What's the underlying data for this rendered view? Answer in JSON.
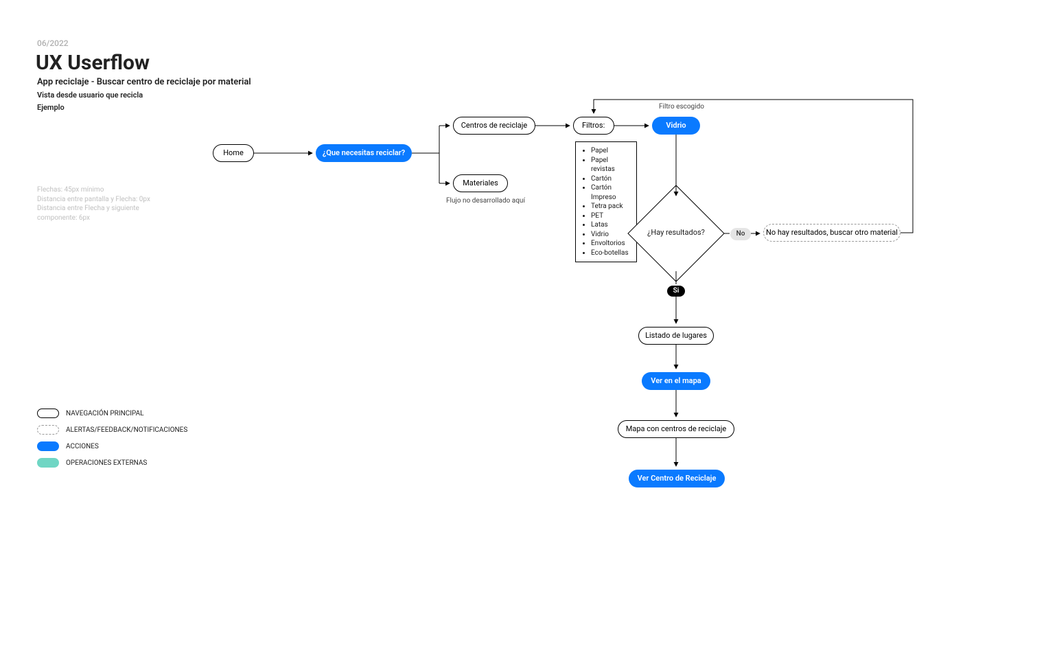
{
  "header": {
    "date": "06/2022",
    "title": "UX Userflow",
    "subtitle": "App reciclaje - Buscar centro de reciclaje por material",
    "subtitle2": "Vista desde usuario que recicla",
    "subtitle3": "Ejemplo"
  },
  "notes": {
    "l1": "Flechas: 45px mínimo",
    "l2": "Distancia entre pantalla y Flecha: 0px",
    "l3": "Distancia entre Flecha y siguiente componente: 6px"
  },
  "legend": {
    "nav": "NAVEGACIÓN PRINCIPAL",
    "alert": "ALERTAS/FEEDBACK/NOTIFICACIONES",
    "action": "ACCIONES",
    "ext": "OPERACIONES EXTERNAS"
  },
  "nodes": {
    "home": "Home",
    "queNecesitas": "¿Que necesitas reciclar?",
    "centros": "Centros de reciclaje",
    "materiales": "Materiales",
    "flujoNo": "Flujo no desarrollado aquí",
    "filtros": "Filtros:",
    "filtroEscogido": "Filtro escogido",
    "vidrio": "Vidrio",
    "hayResultados": "¿Hay resultados?",
    "no": "No",
    "noHay": "No hay resultados, buscar otro material",
    "si": "Si",
    "listado": "Listado de lugares",
    "verMapa": "Ver en el mapa",
    "mapaCentros": "Mapa con  centros de reciclaje",
    "verCentro": "Ver Centro de Reciclaje"
  },
  "filters": {
    "items": [
      "Papel",
      "Papel revistas",
      "Cartón",
      "Cartón Impreso",
      "Tetra pack",
      "PET",
      "Latas",
      "Vidrio",
      "Envoltorios",
      "Eco-botellas"
    ]
  },
  "chart_data": {
    "type": "flowchart",
    "title": "UX Userflow – App reciclaje – Buscar centro de reciclaje por material",
    "legend": {
      "nav": "Navegación principal (pill, black outline)",
      "alert": "Alertas/Feedback/Notificaciones (pill, dashed outline)",
      "action": "Acciones (pill, blue fill)",
      "ext": "Operaciones externas (pill, teal fill)"
    },
    "nodes": [
      {
        "id": "home",
        "label": "Home",
        "kind": "nav"
      },
      {
        "id": "que",
        "label": "¿Que necesitas reciclar?",
        "kind": "action"
      },
      {
        "id": "centros",
        "label": "Centros de reciclaje",
        "kind": "nav"
      },
      {
        "id": "materiales",
        "label": "Materiales",
        "kind": "nav",
        "note": "Flujo no desarrollado aquí"
      },
      {
        "id": "filtros",
        "label": "Filtros:",
        "kind": "nav",
        "options": [
          "Papel",
          "Papel revistas",
          "Cartón",
          "Cartón Impreso",
          "Tetra pack",
          "PET",
          "Latas",
          "Vidrio",
          "Envoltorios",
          "Eco-botellas"
        ]
      },
      {
        "id": "vidrio",
        "label": "Vidrio",
        "kind": "action",
        "note": "Filtro escogido"
      },
      {
        "id": "hay",
        "label": "¿Hay resultados?",
        "kind": "decision"
      },
      {
        "id": "nohay",
        "label": "No hay resultados, buscar otro material",
        "kind": "alert"
      },
      {
        "id": "listado",
        "label": "Listado de lugares",
        "kind": "nav"
      },
      {
        "id": "vermapa",
        "label": "Ver en el mapa",
        "kind": "action"
      },
      {
        "id": "mapa",
        "label": "Mapa con centros de reciclaje",
        "kind": "nav"
      },
      {
        "id": "vercentro",
        "label": "Ver Centro de Reciclaje",
        "kind": "action"
      }
    ],
    "edges": [
      {
        "from": "home",
        "to": "que"
      },
      {
        "from": "que",
        "to": "centros"
      },
      {
        "from": "que",
        "to": "materiales"
      },
      {
        "from": "centros",
        "to": "filtros"
      },
      {
        "from": "filtros",
        "to": "vidrio"
      },
      {
        "from": "vidrio",
        "to": "hay"
      },
      {
        "from": "hay",
        "to": "nohay",
        "label": "No"
      },
      {
        "from": "nohay",
        "to": "filtros",
        "note": "loop back to choose another filter"
      },
      {
        "from": "hay",
        "to": "listado",
        "label": "Si"
      },
      {
        "from": "listado",
        "to": "vermapa"
      },
      {
        "from": "vermapa",
        "to": "mapa"
      },
      {
        "from": "mapa",
        "to": "vercentro"
      }
    ]
  }
}
